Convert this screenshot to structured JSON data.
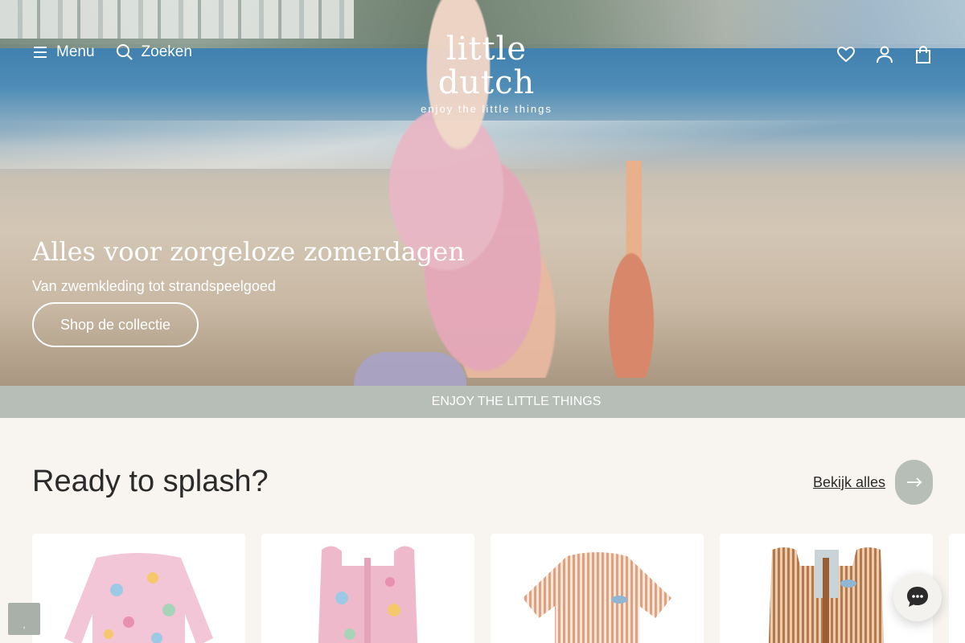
{
  "header": {
    "menu_label": "Menu",
    "search_label": "Zoeken",
    "logo_main": "little dutch",
    "logo_tagline": "enjoy the little things"
  },
  "hero": {
    "title": "Alles voor zorgeloze zomerdagen",
    "subtitle": "Van zwemkleding tot strandspeelgoed",
    "cta_label": "Shop de collectie"
  },
  "banner": {
    "text": "ENJOY THE LITTLE THINGS"
  },
  "section": {
    "title": "Ready to splash?",
    "see_all_label": "Bekijk alles"
  },
  "products": [
    {
      "name": "pink-floral-swimsuit-long-sleeve",
      "color": "#f2c6d6"
    },
    {
      "name": "pink-floral-swim-vest",
      "color": "#efb9cc"
    },
    {
      "name": "orange-striped-swim-shirt",
      "color": "#e0a27e"
    },
    {
      "name": "brown-striped-swim-vest",
      "color": "#b87848"
    }
  ],
  "cookie_label": ",",
  "colors": {
    "banner_bg": "#b7beb8",
    "page_bg": "#f8f5f1",
    "text_dark": "#2b2b2b"
  }
}
